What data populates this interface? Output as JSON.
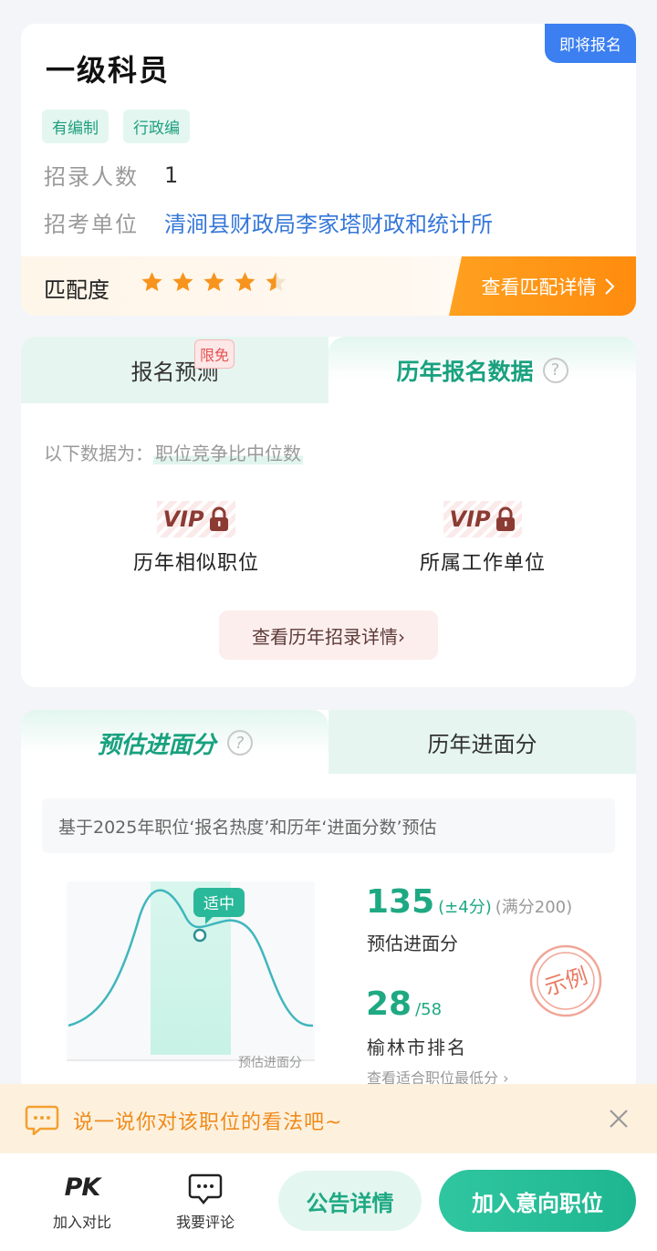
{
  "job": {
    "title": "一级科员",
    "status_badge": "即将报名",
    "tags": [
      "有编制",
      "行政编"
    ],
    "recruit_count_label": "招录人数",
    "recruit_count": "1",
    "unit_label": "招考单位",
    "unit": "清涧县财政局李家塔财政和统计所"
  },
  "match": {
    "label": "匹配度",
    "rating": 4.5,
    "max_rating": 5,
    "detail_btn": "查看匹配详情"
  },
  "signup": {
    "tab_predict": "报名预测",
    "tab_predict_badge": "限免",
    "tab_history": "历年报名数据",
    "help": "?",
    "desc_prefix": "以下数据为：",
    "desc_highlight": "职位竞争比中位数",
    "vip_text": "VIP",
    "vip_items": [
      "历年相似职位",
      "所属工作单位"
    ],
    "history_btn": "查看历年招录详情›"
  },
  "score": {
    "tab_estimate": "预估进面分",
    "tab_history": "历年进面分",
    "help": "?",
    "basis": "基于2025年职位‘报名热度’和历年‘进面分数’预估",
    "chart_badge": "适中",
    "chart_xlabel": "预估进面分",
    "estimate_value": "135",
    "estimate_range": "(±4分)",
    "estimate_full": "(满分200)",
    "estimate_label": "预估进面分",
    "rank_value": "28",
    "rank_total": "/58",
    "rank_label": "榆林市排名",
    "min_link": "查看适合职位最低分 ›",
    "stamp_text": "示例"
  },
  "comment": {
    "prompt": "说一说你对该职位的看法吧~"
  },
  "bottom": {
    "pk_icon_text": "PK",
    "compare_label": "加入对比",
    "comment_label": "我要评论",
    "notice_btn": "公告详情",
    "add_btn": "加入意向职位"
  },
  "colors": {
    "accent_green": "#1ea983",
    "accent_blue": "#3b7ff0",
    "accent_orange": "#ff8c0e",
    "star": "#f7941d"
  }
}
